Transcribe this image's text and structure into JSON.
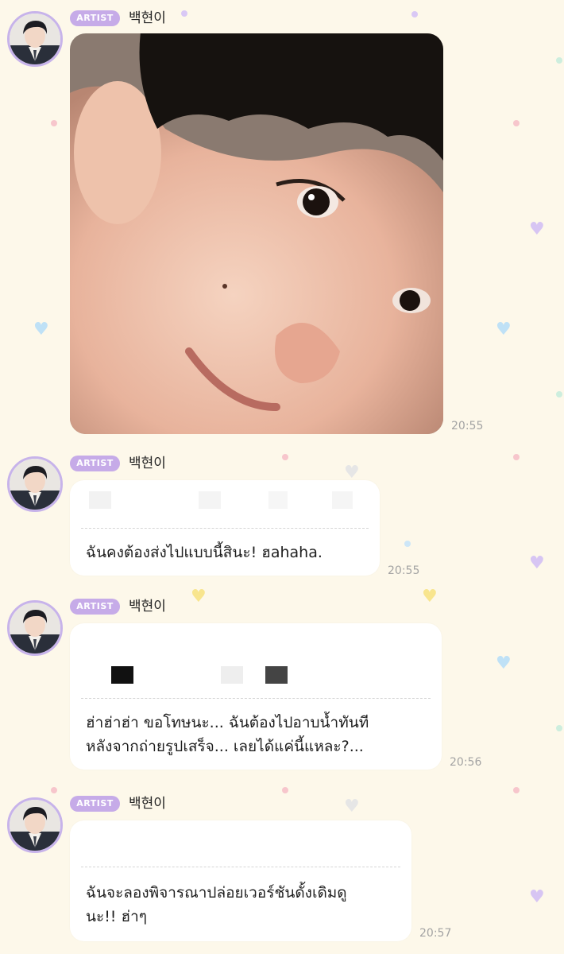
{
  "colors": {
    "background": "#fdf8ea",
    "artist_badge": "#c6abe8",
    "avatar_ring": "#c7b3ea",
    "bubble": "#ffffff",
    "timestamp": "#a3a3a3",
    "text": "#1e1e1e"
  },
  "messages": [
    {
      "badge": "ARTIST",
      "sender": "백현이",
      "type": "photo",
      "time": "20:55"
    },
    {
      "badge": "ARTIST",
      "sender": "백현이",
      "type": "text",
      "text": "ฉันคงต้องส่งไปแบบนี้สินะ! ฮahaha.",
      "time": "20:55"
    },
    {
      "badge": "ARTIST",
      "sender": "백현이",
      "type": "text",
      "text": "ฮ่าฮ่าฮ่า ขอโทษนะ... ฉันต้องไปอาบน้ำทันที\nหลังจากถ่ายรูปเสร็จ... เลยได้แค่นี้แหละ?...",
      "time": "20:56"
    },
    {
      "badge": "ARTIST",
      "sender": "백현이",
      "type": "text",
      "text": "ฉันจะลองพิจารณาปล่อยเวอร์ชันดั้งเดิมดู\nนะ!! ฮ่าๆ",
      "time": "20:57"
    }
  ]
}
